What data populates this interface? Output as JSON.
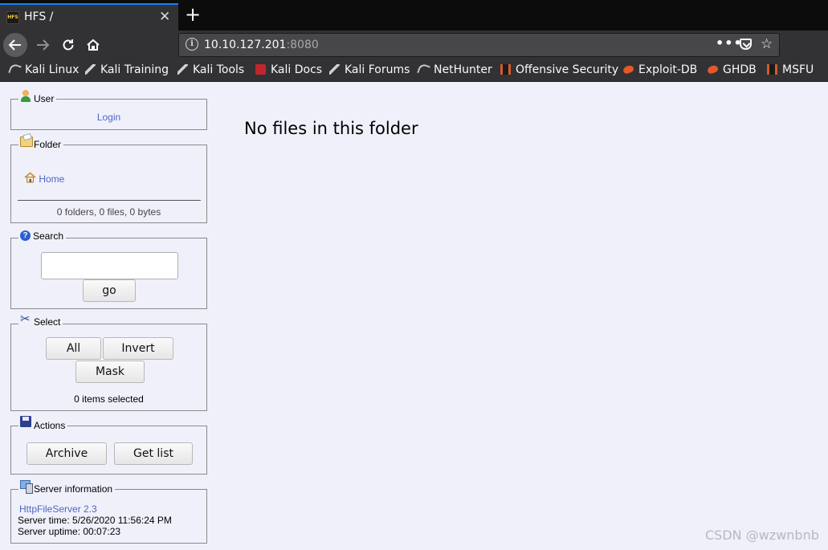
{
  "browser": {
    "tab_title": "HFS /",
    "tab_favicon": "HFS",
    "new_tab_label": "+",
    "tab_close_label": "✕",
    "url_host": "10.10.127.201",
    "url_port": ":8080"
  },
  "bookmarks": [
    {
      "label": "Kali Linux",
      "icon": "kali-dragon-icon"
    },
    {
      "label": "Kali Training",
      "icon": "kali-dragon-icon"
    },
    {
      "label": "Kali Tools",
      "icon": "kali-dragon-icon"
    },
    {
      "label": "Kali Docs",
      "icon": "kali-docs-icon"
    },
    {
      "label": "Kali Forums",
      "icon": "kali-dragon-icon"
    },
    {
      "label": "NetHunter",
      "icon": "nethunter-icon"
    },
    {
      "label": "Offensive Security",
      "icon": "offsec-icon"
    },
    {
      "label": "Exploit-DB",
      "icon": "exploitdb-icon"
    },
    {
      "label": "GHDB",
      "icon": "exploitdb-icon"
    },
    {
      "label": "MSFU",
      "icon": "offsec-icon"
    }
  ],
  "sidebar": {
    "user": {
      "title": "User",
      "login_label": "Login"
    },
    "folder": {
      "title": "Folder",
      "home_label": "Home",
      "summary": "0 folders, 0 files, 0 bytes"
    },
    "search": {
      "title": "Search",
      "input_value": "",
      "go_label": "go"
    },
    "select": {
      "title": "Select",
      "all_label": "All",
      "invert_label": "Invert",
      "mask_label": "Mask",
      "status": "0 items selected"
    },
    "actions": {
      "title": "Actions",
      "archive_label": "Archive",
      "getlist_label": "Get list"
    },
    "server": {
      "title": "Server information",
      "version_label": "HttpFileServer 2.3",
      "server_time": "Server time: 5/26/2020 11:56:24 PM",
      "server_uptime": "Server uptime: 00:07:23"
    }
  },
  "main": {
    "message": "No files in this folder"
  },
  "watermark": "CSDN @wzwnbnb",
  "colors": {
    "link": "#4d67c4",
    "page_bg": "#f0f0fb",
    "tab_accent": "#0a84ff"
  }
}
